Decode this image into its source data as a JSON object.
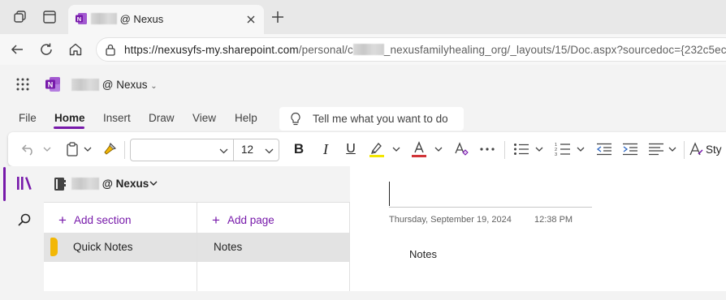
{
  "browser": {
    "tab_title_suffix": "@ Nexus",
    "url_host": "https://nexusyfs-my.sharepoint.com",
    "url_path_a": "/personal/c",
    "url_path_b": "_nexusfamilyhealing_org/_layouts/15/Doc.aspx?sourcedoc={232c5ec"
  },
  "app": {
    "notebook_title_suffix": "@ Nexus"
  },
  "menu": {
    "file": "File",
    "home": "Home",
    "insert": "Insert",
    "draw": "Draw",
    "view": "View",
    "help": "Help",
    "tell_me": "Tell me what you want to do"
  },
  "ribbon": {
    "font_name": "",
    "font_size": "12",
    "styles_label": "Sty"
  },
  "notebook": {
    "name_suffix": "@ Nexus",
    "add_section": "Add section",
    "add_page": "Add page",
    "sections": [
      {
        "label": "Quick Notes",
        "color": "#f2b705"
      }
    ],
    "pages": [
      {
        "label": "Notes"
      }
    ]
  },
  "page": {
    "title": "",
    "date": "Thursday, September 19, 2024",
    "time": "12:38 PM",
    "body": "Notes"
  },
  "colors": {
    "accent": "#7719aa",
    "onenote_brand": "#7719aa",
    "highlight": "#f3e600",
    "font_color": "#d13438"
  }
}
